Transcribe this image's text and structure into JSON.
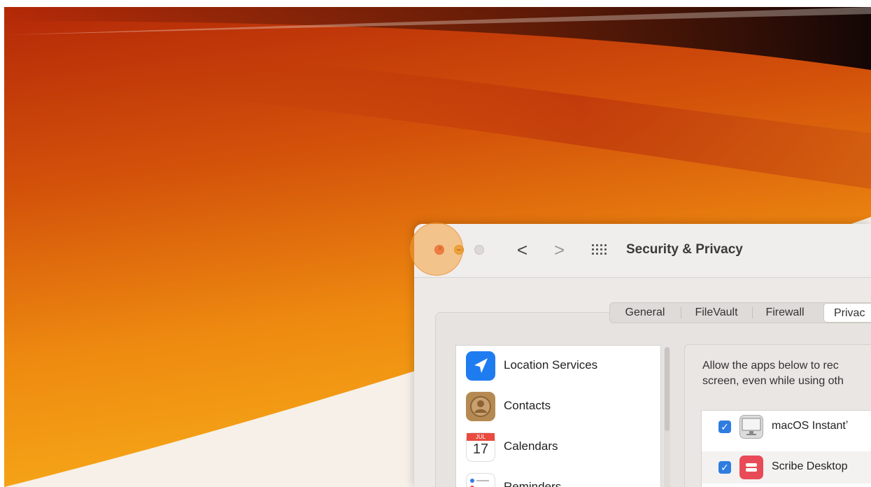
{
  "window": {
    "title": "Security & Privacy",
    "nav": {
      "back": "<",
      "forward": ">"
    }
  },
  "tabs": [
    "General",
    "FileVault",
    "Firewall",
    "Privac"
  ],
  "selected_tab": "Privac",
  "services": [
    {
      "label": "Location Services",
      "icon": "location-arrow-icon",
      "color": "#1f7cf0"
    },
    {
      "label": "Contacts",
      "icon": "contacts-icon",
      "color": "#b58a52"
    },
    {
      "label": "Calendars",
      "icon": "calendar-icon",
      "color": "#ffffff",
      "month": "JUL",
      "day": "17"
    },
    {
      "label": "Reminders",
      "icon": "reminders-icon",
      "color": "#ffffff"
    }
  ],
  "description": {
    "line1": "Allow the apps below to rec",
    "line2": "screen, even while using oth"
  },
  "apps": [
    {
      "name": "macOS Instantʼ",
      "checked": true,
      "icon": "monitor-app-icon"
    },
    {
      "name": "Scribe Desktop",
      "checked": true,
      "icon": "scribe-app-icon",
      "color": "#e84b57"
    }
  ],
  "colors": {
    "accent_checkbox": "#2f7de1",
    "close": "#e9524a",
    "minimize": "#e6a33a",
    "zoom_disabled": "#dcd8d5"
  }
}
